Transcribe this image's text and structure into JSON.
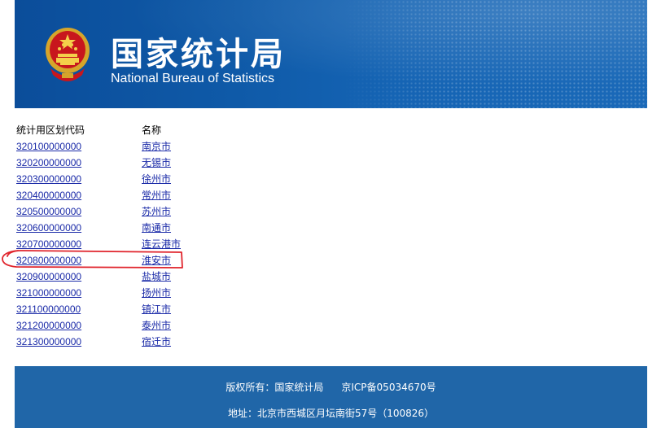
{
  "header": {
    "title_cn": "国家统计局",
    "title_en": "National Bureau of Statistics",
    "emblem_icon": "national-emblem-icon",
    "banner_color": "#0f5aa8"
  },
  "table": {
    "col_code": "统计用区划代码",
    "col_name": "名称",
    "rows": [
      {
        "code": "320100000000",
        "name": "南京市"
      },
      {
        "code": "320200000000",
        "name": "无锡市"
      },
      {
        "code": "320300000000",
        "name": "徐州市"
      },
      {
        "code": "320400000000",
        "name": "常州市"
      },
      {
        "code": "320500000000",
        "name": "苏州市"
      },
      {
        "code": "320600000000",
        "name": "南通市"
      },
      {
        "code": "320700000000",
        "name": "连云港市"
      },
      {
        "code": "320800000000",
        "name": "淮安市"
      },
      {
        "code": "320900000000",
        "name": "盐城市"
      },
      {
        "code": "321000000000",
        "name": "扬州市"
      },
      {
        "code": "321100000000",
        "name": "镇江市"
      },
      {
        "code": "321200000000",
        "name": "泰州市"
      },
      {
        "code": "321300000000",
        "name": "宿迁市"
      }
    ],
    "link_color": "#1b2ba8",
    "highlight_color": "#e0242c"
  },
  "footer": {
    "copyright": "版权所有：国家统计局",
    "icp": "京ICP备05034670号",
    "address": "地址：北京市西城区月坛南街57号（100826）",
    "bg_color": "#2066a8"
  }
}
